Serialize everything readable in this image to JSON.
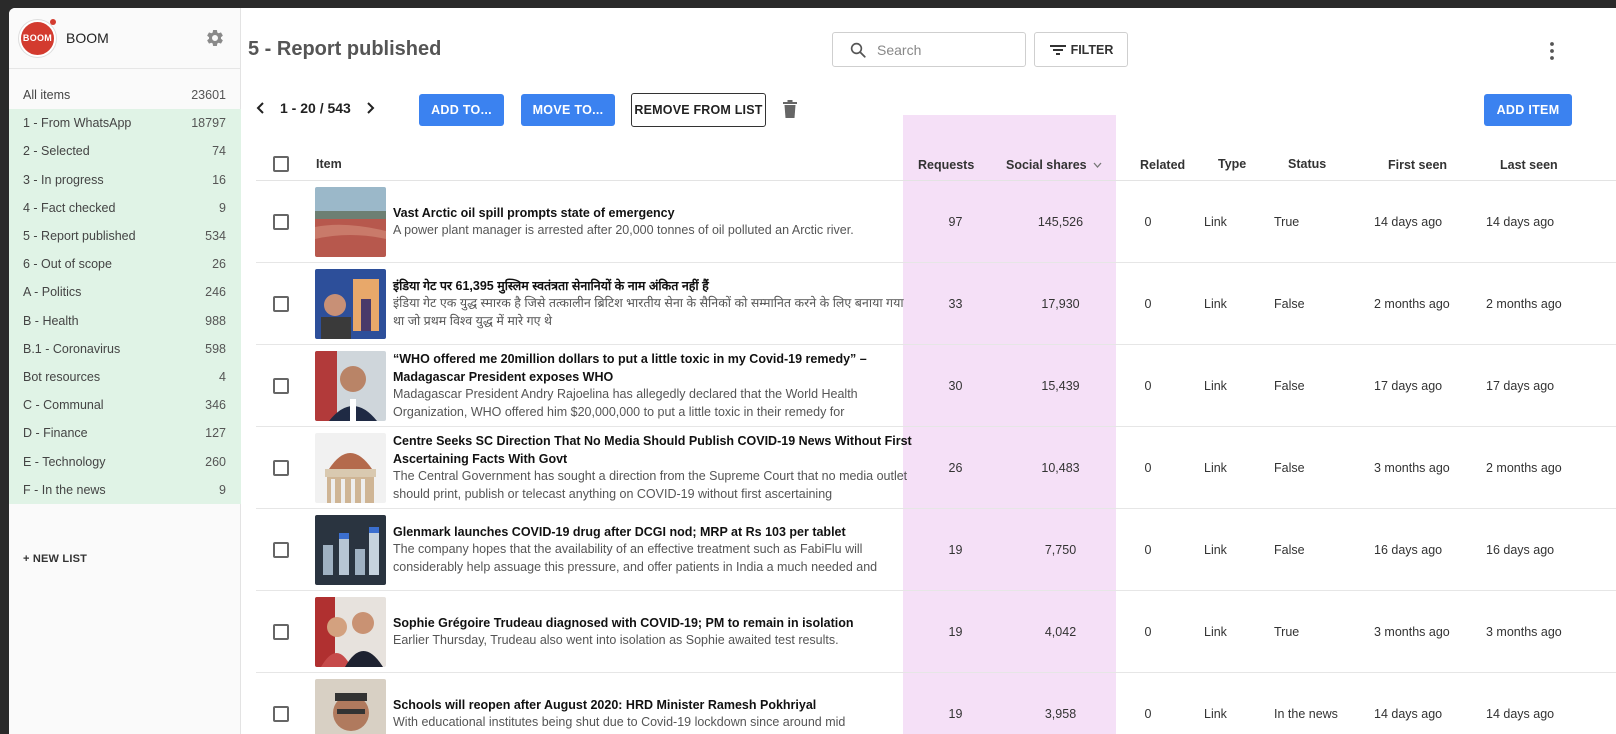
{
  "app": {
    "name": "BOOM",
    "logo_text": "BOOM"
  },
  "sidebar": {
    "items": [
      {
        "label": "All items",
        "count": "23601",
        "highlight": false
      },
      {
        "label": "1 - From WhatsApp",
        "count": "18797",
        "highlight": true
      },
      {
        "label": "2 - Selected",
        "count": "74",
        "highlight": true
      },
      {
        "label": "3 - In progress",
        "count": "16",
        "highlight": true
      },
      {
        "label": "4 - Fact checked",
        "count": "9",
        "highlight": true
      },
      {
        "label": "5 - Report published",
        "count": "534",
        "highlight": true
      },
      {
        "label": "6 - Out of scope",
        "count": "26",
        "highlight": true
      },
      {
        "label": "A - Politics",
        "count": "246",
        "highlight": true
      },
      {
        "label": "B - Health",
        "count": "988",
        "highlight": true
      },
      {
        "label": "B.1 - Coronavirus",
        "count": "598",
        "highlight": true
      },
      {
        "label": "Bot resources",
        "count": "4",
        "highlight": true
      },
      {
        "label": "C - Communal",
        "count": "346",
        "highlight": true
      },
      {
        "label": "D - Finance",
        "count": "127",
        "highlight": true
      },
      {
        "label": "E - Technology",
        "count": "260",
        "highlight": true
      },
      {
        "label": "F - In the news",
        "count": "9",
        "highlight": true
      }
    ],
    "new_list_label": "+ NEW LIST"
  },
  "header": {
    "title": "5 - Report published",
    "search_placeholder": "Search",
    "filter_label": "FILTER"
  },
  "toolbar": {
    "pagination": "1 - 20 / 543",
    "add_to_label": "ADD TO...",
    "move_to_label": "MOVE TO...",
    "remove_label": "REMOVE FROM LIST",
    "add_item_label": "ADD ITEM"
  },
  "table": {
    "columns": {
      "item": "Item",
      "requests": "Requests",
      "social_shares": "Social shares",
      "related": "Related",
      "type": "Type",
      "status": "Status",
      "first_seen": "First seen",
      "last_seen": "Last seen"
    },
    "rows": [
      {
        "title": "Vast Arctic oil spill prompts state of emergency",
        "desc": "A power plant manager is arrested after 20,000 tonnes of oil polluted an Arctic river.",
        "requests": "97",
        "shares": "145,526",
        "related": "0",
        "type": "Link",
        "status": "True",
        "first_seen": "14 days ago",
        "last_seen": "14 days ago",
        "thumb": "oil"
      },
      {
        "title": "इंडिया गेट पर 61,395 मुस्लिम स्वतंत्रता सेनानियों के नाम अंकित नहीं हैं",
        "desc": "इंडिया गेट एक युद्ध स्मारक है जिसे तत्कालीन ब्रिटिश भारतीय सेना के सैनिकों को सम्मानित करने के लिए बनाया गया था जो प्रथम विश्व युद्ध में मारे गए थे",
        "requests": "33",
        "shares": "17,930",
        "related": "0",
        "type": "Link",
        "status": "False",
        "first_seen": "2 months ago",
        "last_seen": "2 months ago",
        "thumb": "gate"
      },
      {
        "title": "“WHO offered me 20million dollars to put a little toxic in my Covid-19 remedy” – Madagascar President exposes WHO",
        "desc": "Madagascar President Andry Rajoelina has allegedly declared that the World Health Organization, WHO offered him $20,000,000 to put a little toxic in their remedy for",
        "requests": "30",
        "shares": "15,439",
        "related": "0",
        "type": "Link",
        "status": "False",
        "first_seen": "17 days ago",
        "last_seen": "17 days ago",
        "thumb": "person"
      },
      {
        "title": "Centre Seeks SC Direction That No Media Should Publish COVID-19 News Without First Ascertaining Facts With Govt",
        "desc": "The Central Government has sought a direction from the Supreme Court that no media outlet should print, publish or telecast anything on COVID-19 without first ascertaining",
        "requests": "26",
        "shares": "10,483",
        "related": "0",
        "type": "Link",
        "status": "False",
        "first_seen": "3 months ago",
        "last_seen": "2 months ago",
        "thumb": "dome"
      },
      {
        "title": "Glenmark launches COVID-19 drug after DCGI nod; MRP at Rs 103 per tablet",
        "desc": "The company hopes that the availability of an effective treatment such as FabiFlu will considerably help assuage this pressure, and offer patients in India a much needed and timely",
        "requests": "19",
        "shares": "7,750",
        "related": "0",
        "type": "Link",
        "status": "False",
        "first_seen": "16 days ago",
        "last_seen": "16 days ago",
        "thumb": "vials"
      },
      {
        "title": "Sophie Grégoire Trudeau diagnosed with COVID-19; PM to remain in isolation",
        "desc": "Earlier Thursday, Trudeau also went into isolation as Sophie awaited test results.",
        "requests": "19",
        "shares": "4,042",
        "related": "0",
        "type": "Link",
        "status": "True",
        "first_seen": "3 months ago",
        "last_seen": "3 months ago",
        "thumb": "couple"
      },
      {
        "title": "Schools will reopen after August 2020: HRD Minister Ramesh Pokhriyal",
        "desc": "With educational institutes being shut due to Covid-19 lockdown since around mid",
        "requests": "19",
        "shares": "3,958",
        "related": "0",
        "type": "Link",
        "status": "In the news",
        "first_seen": "14 days ago",
        "last_seen": "14 days ago",
        "thumb": "man"
      }
    ]
  },
  "colors": {
    "accent": "#3b82f0",
    "list_highlight": "#e0f3e6",
    "column_highlight": "#f5e0f7",
    "logo": "#d33b2f"
  }
}
